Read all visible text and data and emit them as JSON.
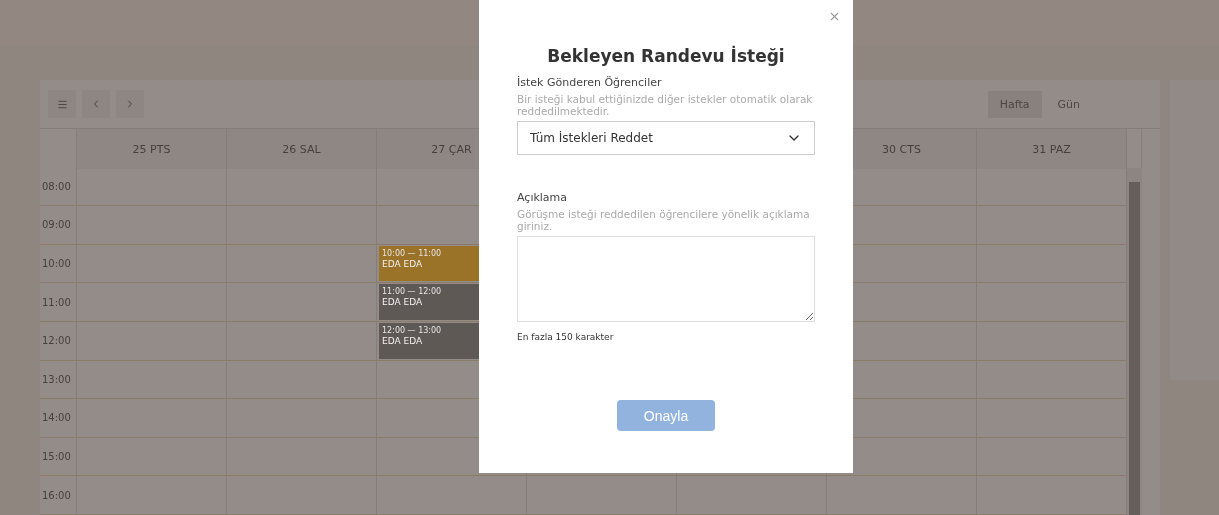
{
  "toolbar": {
    "view_tabs": [
      {
        "label": "Hafta",
        "selected": true
      },
      {
        "label": "Gün",
        "selected": false
      }
    ]
  },
  "calendar": {
    "days": [
      "25 PTS",
      "26 SAL",
      "27 ÇAR",
      "30 CTS",
      "31 PAZ"
    ],
    "rows": [
      {
        "time": "08:00"
      },
      {
        "time": "09:00"
      },
      {
        "time": "10:00",
        "event": {
          "time": "10:00 — 11:00",
          "name": "EDA EDA",
          "color": "#9a7228"
        }
      },
      {
        "time": "11:00",
        "event": {
          "time": "11:00 — 12:00",
          "name": "EDA EDA",
          "color": "#5f5956"
        }
      },
      {
        "time": "12:00",
        "event": {
          "time": "12:00 — 13:00",
          "name": "EDA EDA",
          "color": "#5f5956"
        }
      },
      {
        "time": "13:00"
      },
      {
        "time": "14:00"
      },
      {
        "time": "15:00"
      },
      {
        "time": "16:00"
      }
    ]
  },
  "modal": {
    "title": "Bekleyen Randevu İsteği",
    "students_label": "İstek Gönderen Öğrenciler",
    "students_hint": "Bir isteği kabul ettiğinizde diğer istekler otomatik olarak reddedilmektedir.",
    "select_value": "Tüm İstekleri Reddet",
    "note_label": "Açıklama",
    "note_hint": "Görüşme isteği reddedilen öğrencilere yönelik açıklama giriniz.",
    "limit": "En fazla 150 karakter",
    "confirm": "Onayla"
  }
}
